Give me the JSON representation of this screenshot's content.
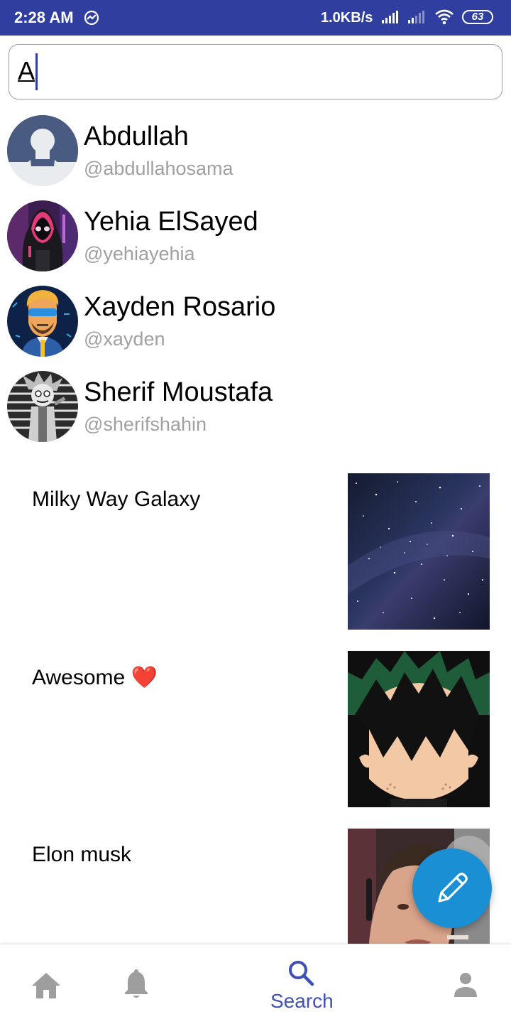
{
  "status_bar": {
    "time": "2:28 AM",
    "net_speed": "1.0KB/s",
    "battery": "63",
    "app_icon": "messenger-icon"
  },
  "search": {
    "value": "A"
  },
  "users": [
    {
      "name": "Abdullah",
      "handle": "@abdullahosama",
      "avatar": "default-person-avatar"
    },
    {
      "name": "Yehia ElSayed",
      "handle": "@yehiayehia",
      "avatar": "hooded-figure-avatar"
    },
    {
      "name": "Xayden Rosario",
      "handle": "@xayden",
      "avatar": "bearded-man-sunglasses-avatar"
    },
    {
      "name": "Sherif Moustafa",
      "handle": "@sherifshahin",
      "avatar": "cartoon-scientist-avatar"
    }
  ],
  "posts": [
    {
      "title": "Milky Way Galaxy",
      "emoji": "",
      "image": "starry-sky-image"
    },
    {
      "title": "Awesome",
      "emoji": "❤️",
      "image": "anime-boy-image"
    },
    {
      "title": "Elon musk",
      "emoji": "",
      "image": "man-smoking-photo"
    }
  ],
  "fab": {
    "icon": "pencil-icon"
  },
  "bottom_nav": {
    "items": [
      {
        "icon": "home-icon",
        "label": ""
      },
      {
        "icon": "bell-icon",
        "label": ""
      },
      {
        "icon": "search-icon",
        "label": "Search"
      },
      {
        "icon": "person-icon",
        "label": ""
      }
    ],
    "active_index": 2
  },
  "colors": {
    "status_bar": "#303f9f",
    "accent": "#3f51b5",
    "fab": "#1b8fd4",
    "inactive_icon": "#9e9e9e",
    "handle_text": "#a0a0a0"
  }
}
